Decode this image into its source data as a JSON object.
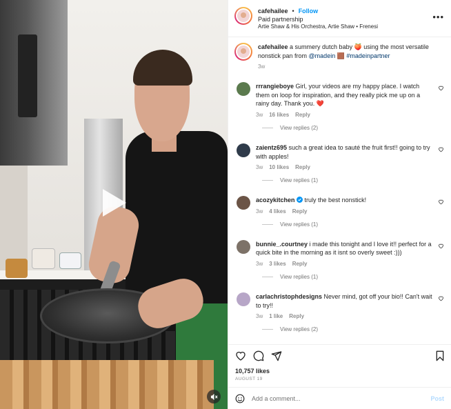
{
  "header": {
    "username": "cafehailee",
    "separator": "•",
    "follow_label": "Follow",
    "paid_partnership": "Paid partnership",
    "music": "Artie Shaw & His Orchestra, Artie Shaw • Frenesi",
    "more_icon": "more-horizontal-icon"
  },
  "caption": {
    "username": "cafehailee",
    "text_before": " a summery dutch baby 🍑 using the most versatile nonstick pan from ",
    "mention": "@madein",
    "text_middle": " 🟫 ",
    "hashtag": "#madeinpartner",
    "time": "3w"
  },
  "comments": [
    {
      "username": "rrrangieboye",
      "text": " Girl, your videos are my happy place. I watch them on loop for inspiration, and they really pick me up on a rainy day. Thank you. ",
      "emoji": "❤️",
      "time": "3w",
      "likes": "16 likes",
      "reply_label": "Reply",
      "view_replies": "View replies (2)",
      "avatar_color": "#5b7a4e"
    },
    {
      "username": "zaientz695",
      "text": " such a great idea to sauté the fruit first!! going to try with apples!",
      "emoji": "",
      "time": "3w",
      "likes": "10 likes",
      "reply_label": "Reply",
      "view_replies": "View replies (1)",
      "avatar_color": "#2f3b4a"
    },
    {
      "username": "acozykitchen",
      "text": " truly the best nonstick!",
      "emoji": "",
      "time": "3w",
      "likes": "4 likes",
      "reply_label": "Reply",
      "view_replies": "View replies (1)",
      "avatar_color": "#6b5446",
      "verified": true
    },
    {
      "username": "bunnie_.courtney",
      "text": " i made this tonight and I love it!! perfect for a quick bite in the morning as it isnt so overly sweet :)))",
      "emoji": "",
      "time": "3w",
      "likes": "3 likes",
      "reply_label": "Reply",
      "view_replies": "View replies (1)",
      "avatar_color": "#7d7268"
    },
    {
      "username": "carlachristophdesigns",
      "text": " Never mind, got off your bio!! Can't wait to try!!",
      "emoji": "",
      "time": "3w",
      "likes": "1 like",
      "reply_label": "Reply",
      "view_replies": "View replies (2)",
      "avatar_color": "#b7a6c7"
    }
  ],
  "actions": {
    "likes": "10,757 likes",
    "date": "AUGUST 19",
    "icons": [
      "heart-icon",
      "comment-icon",
      "share-icon",
      "bookmark-icon"
    ]
  },
  "composer": {
    "placeholder": "Add a comment...",
    "post_label": "Post",
    "emoji_icon": "emoji-icon"
  },
  "video": {
    "play_icon": "play-icon",
    "mute_icon": "muted-speaker-icon"
  },
  "colors": {
    "link_blue": "#0095f6",
    "mention": "#00376b",
    "muted_text": "#8e8e8e",
    "heart_red": "#ed4956"
  }
}
